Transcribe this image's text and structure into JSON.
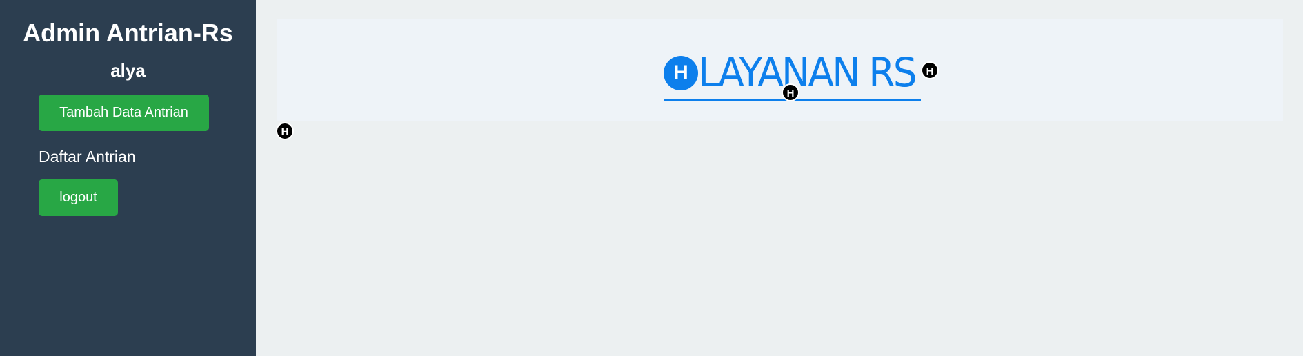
{
  "sidebar": {
    "title": "Admin Antrian-Rs",
    "username": "alya",
    "add_button_label": "Tambah Data Antrian",
    "queue_list_label": "Daftar Antrian",
    "logout_label": "logout"
  },
  "header": {
    "logo_badge": "H",
    "logo_text": "LAYANAN RS"
  },
  "markers": {
    "marker_1": "H",
    "marker_2": "H",
    "marker_3": "H"
  },
  "colors": {
    "sidebar_bg": "#2c3e50",
    "main_bg": "#ecf0f1",
    "button_green": "#28a745",
    "brand_blue": "#0d7fec"
  },
  "icons": {
    "logo_badge": "hospital-h-icon",
    "markers": "hospital-h-icon"
  }
}
